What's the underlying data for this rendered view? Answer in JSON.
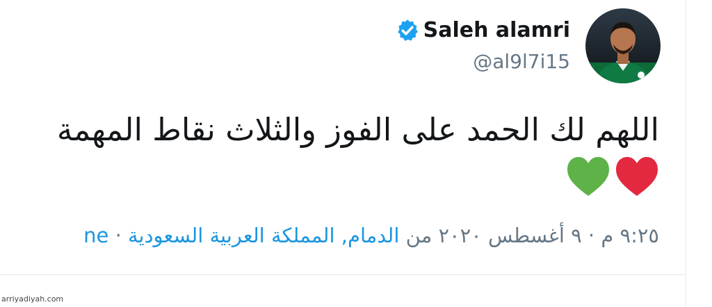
{
  "user": {
    "display_name": "Saleh alamri",
    "handle": "@al9l7i15",
    "verified_icon": "verified-badge-icon",
    "avatar_icon": "profile-photo"
  },
  "tweet": {
    "text": "اللهم لك الحمد على الفوز والثلاث نقاط المهمة",
    "emojis": [
      "red-heart-icon",
      "green-heart-icon"
    ]
  },
  "meta": {
    "time_date": "٩:٢٥ م · ٩ أغسطس ٢٠٢٠ من",
    "location": "الدمام, المملكة العربية السعودية",
    "separator": "·",
    "source_cut": "ne"
  },
  "watermark": "arriyadiyah.com",
  "colors": {
    "verified_blue": "#1da1f2",
    "link_blue": "#1b95e0",
    "heart_red": "#e2293f",
    "heart_green": "#5eb247",
    "muted": "#657786"
  }
}
